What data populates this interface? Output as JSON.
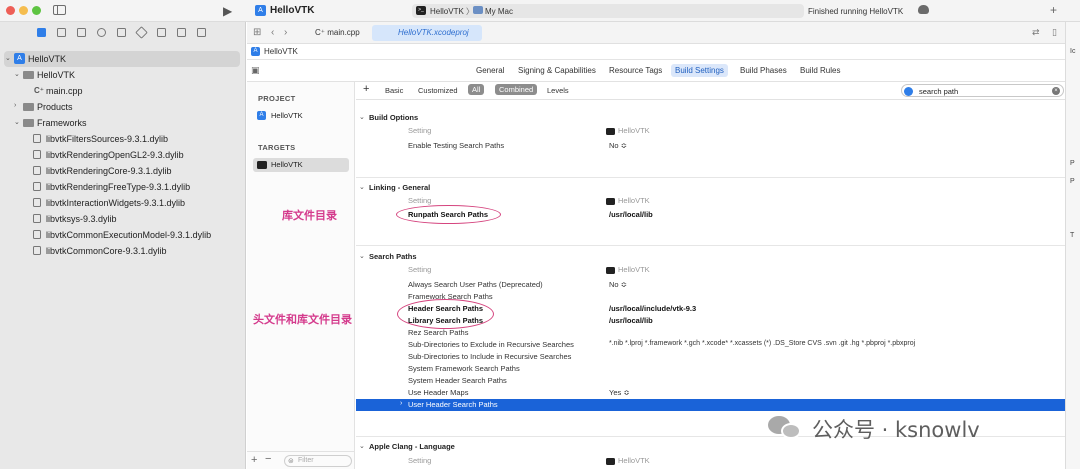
{
  "window": {
    "app_title": "HelloVTK",
    "scheme": "HelloVTK",
    "scheme_separator": "〉",
    "destination": "My Mac",
    "status": "Finished running HelloVTK"
  },
  "navigator": {
    "items": [
      {
        "label": "HelloVTK",
        "kind": "project",
        "disclosure": "⌄"
      },
      {
        "label": "HelloVTK",
        "kind": "folder",
        "disclosure": "⌄"
      },
      {
        "label": "main.cpp",
        "kind": "cpp"
      },
      {
        "label": "Products",
        "kind": "folder",
        "disclosure": "›"
      },
      {
        "label": "Frameworks",
        "kind": "folder",
        "disclosure": "⌄"
      },
      {
        "label": "libvtkFiltersSources-9.3.1.dylib",
        "kind": "lib"
      },
      {
        "label": "libvtkRenderingOpenGL2-9.3.dylib",
        "kind": "lib"
      },
      {
        "label": "libvtkRenderingCore-9.3.1.dylib",
        "kind": "lib"
      },
      {
        "label": "libvtkRenderingFreeType-9.3.1.dylib",
        "kind": "lib"
      },
      {
        "label": "libvtkInteractionWidgets-9.3.1.dylib",
        "kind": "lib"
      },
      {
        "label": "libvtksys-9.3.dylib",
        "kind": "lib"
      },
      {
        "label": "libvtkCommonExecutionModel-9.3.1.dylib",
        "kind": "lib"
      },
      {
        "label": "libvtkCommonCore-9.3.1.dylib",
        "kind": "lib"
      }
    ]
  },
  "editor": {
    "tab_main": "C⁺ main.cpp",
    "tab_project": "HelloVTK.xcodeproj",
    "breadcrumb": "HelloVTK"
  },
  "settings_tabs": [
    "General",
    "Signing & Capabilities",
    "Resource Tags",
    "Build Settings",
    "Build Phases",
    "Build Rules"
  ],
  "project_pane": {
    "project_heading": "PROJECT",
    "project_item": "HelloVTK",
    "targets_heading": "TARGETS",
    "target_item": "HelloVTK",
    "filter_placeholder": "Filter"
  },
  "filterbar": {
    "add": "+",
    "basic": "Basic",
    "customized": "Customized",
    "all": "All",
    "combined": "Combined",
    "levels": "Levels",
    "search_value": "search path"
  },
  "sections": {
    "build_options": {
      "title": "Build Options",
      "col_setting": "Setting",
      "col_target": "HelloVTK",
      "rows": [
        {
          "name": "Enable Testing Search Paths",
          "value": "No ≎"
        }
      ]
    },
    "linking": {
      "title": "Linking - General",
      "col_setting": "Setting",
      "col_target": "HelloVTK",
      "rows": [
        {
          "name": "Runpath Search Paths",
          "value": "/usr/local/lib"
        }
      ]
    },
    "search_paths": {
      "title": "Search Paths",
      "col_setting": "Setting",
      "col_target": "HelloVTK",
      "rows": [
        {
          "name": "Always Search User Paths (Deprecated)",
          "value": "No ≎"
        },
        {
          "name": "Framework Search Paths",
          "value": ""
        },
        {
          "name": "Header Search Paths",
          "value": "/usr/local/include/vtk-9.3"
        },
        {
          "name": "Library Search Paths",
          "value": "/usr/local/lib"
        },
        {
          "name": "Rez Search Paths",
          "value": ""
        },
        {
          "name": "Sub-Directories to Exclude in Recursive Searches",
          "value": "*.nib *.lproj *.framework *.gch *.xcode* *.xcassets (*) .DS_Store CVS .svn .git .hg *.pbproj *.pbxproj"
        },
        {
          "name": "Sub-Directories to Include in Recursive Searches",
          "value": ""
        },
        {
          "name": "System Framework Search Paths",
          "value": ""
        },
        {
          "name": "System Header Search Paths",
          "value": ""
        },
        {
          "name": "Use Header Maps",
          "value": "Yes ≎"
        },
        {
          "name": "User Header Search Paths",
          "value": ""
        }
      ]
    },
    "apple_clang": {
      "title": "Apple Clang - Language",
      "col_setting": "Setting",
      "col_target": "HelloVTK"
    }
  },
  "annotations": {
    "library_dir": "库文件目录",
    "header_and_library_dir": "头文件和库文件目录"
  },
  "inspector_letters": [
    "Ic",
    "P",
    "P",
    "T"
  ],
  "watermark": "公众号 · ksnowlv",
  "colors": {
    "accent": "#2f7ee8",
    "selection": "#1a63d8",
    "annotation": "#d43a8c"
  }
}
